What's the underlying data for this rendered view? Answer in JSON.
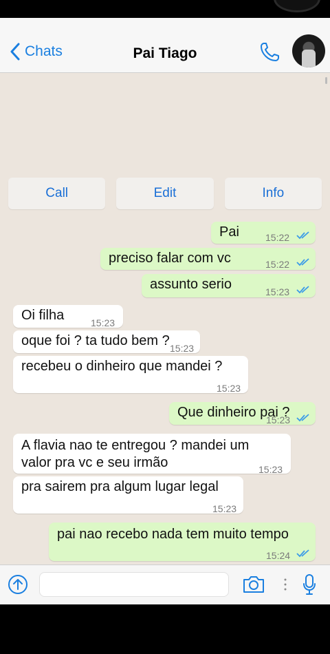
{
  "header": {
    "back_label": "Chats",
    "title": "Pai Tiago"
  },
  "actions": {
    "call": "Call",
    "edit": "Edit",
    "info": "Info"
  },
  "messages": [
    {
      "text": "Pai",
      "time": "15:22",
      "dir": "out"
    },
    {
      "text": "preciso falar com vc",
      "time": "15:22",
      "dir": "out"
    },
    {
      "text": "assunto serio",
      "time": "15:23",
      "dir": "out"
    },
    {
      "text": "Oi filha",
      "time": "15:23",
      "dir": "in"
    },
    {
      "text": "oque foi ? ta tudo bem ?",
      "time": "15:23",
      "dir": "in"
    },
    {
      "text": "recebeu o dinheiro que mandei ?",
      "time": "15:23",
      "dir": "in"
    },
    {
      "text": "Que dinheiro pai ?",
      "time": "15:23",
      "dir": "out"
    },
    {
      "text": "A flavia nao te entregou ? mandei um valor pra vc e seu irmão",
      "time": "15:23",
      "dir": "in"
    },
    {
      "text": "pra sairem pra algum lugar legal",
      "time": "15:23",
      "dir": "in"
    },
    {
      "text": "pai nao recebo nada tem muito tempo",
      "time": "15:24",
      "dir": "out"
    }
  ],
  "colors": {
    "accent": "#1a7fe0",
    "outgoing_bubble": "#dcf8c6",
    "incoming_bubble": "#ffffff",
    "chat_background": "#ece5dd",
    "read_ticks": "#3b9be8"
  },
  "icons": [
    "chevron-left-icon",
    "phone-icon",
    "upload-icon",
    "camera-icon",
    "more-dots-icon",
    "microphone-icon"
  ]
}
